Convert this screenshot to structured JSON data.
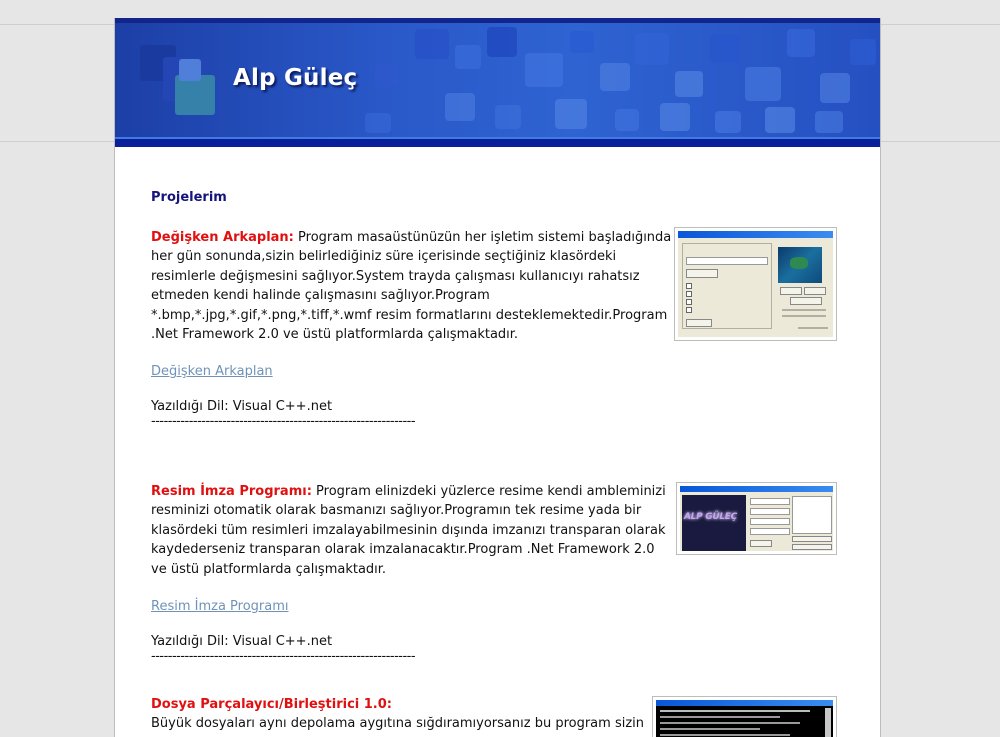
{
  "site": {
    "title": "Alp Güleç"
  },
  "section_title": "Projelerim",
  "projects": [
    {
      "name": "Değişken Arkaplan:",
      "description": " Program masaüstünüzün her işletim sistemi başladığında her gün sonunda,sizin belirlediğiniz süre içerisinde seçtiğiniz klasördeki resimlerle değişmesini sağlıyor.System trayda çalışması kullanıcıyı rahatsız etmeden kendi halinde çalışmasını sağlıyor.Program *.bmp,*.jpg,*.gif,*.png,*.tiff,*.wmf resim formatlarını desteklemektedir.Program .Net Framework 2.0 ve üstü platformlarda çalışmaktadır.",
      "link": "Değişken Arkaplan",
      "language": "Yazıldığı Dil: Visual C++.net",
      "separator": "---------------------------------------------------------------"
    },
    {
      "name": "Resim İmza Programı:",
      "description": " Program elinizdeki yüzlerce resime kendi ambleminizi resminizi otomatik olarak basmanızı sağlıyor.Programın tek resime yada bir klasördeki tüm resimleri imzalayabilmesinin dışında imzanızı transparan olarak kaydederseniz transparan olarak imzalanacaktır.Program .Net Framework 2.0 ve üstü platformlarda çalışmaktadır.",
      "link": "Resim İmza Programı",
      "language": "Yazıldığı Dil: Visual C++.net",
      "separator": "---------------------------------------------------------------"
    },
    {
      "name": "Dosya Parçalayıcı/Birleştirici 1.0:",
      "description": "Büyük dosyaları aynı depolama aygıtına sığdıramıyorsanız bu program sizin"
    }
  ],
  "screenshots": {
    "shot1": {
      "logo_text": "ALP GÜLEÇ"
    },
    "shot2": {
      "logo_text": "ALP GÜLEÇ"
    }
  },
  "colors": {
    "project_name": "#e01010",
    "section_title": "#14147a",
    "link": "#6f93b8",
    "banner": "#2a58c8"
  }
}
